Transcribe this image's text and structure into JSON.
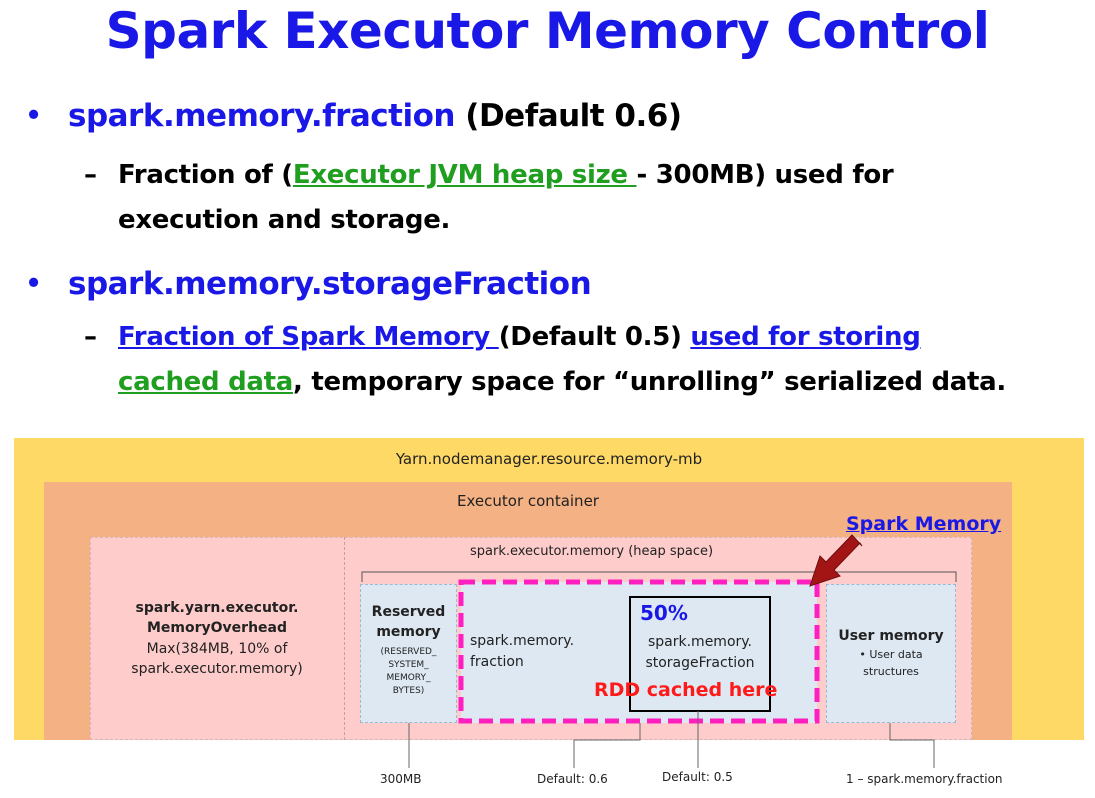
{
  "title": "Spark Executor Memory Control",
  "bullet1": {
    "key": "spark.memory.fraction",
    "rest": " (Default 0.6)"
  },
  "sub1": {
    "dash": "–",
    "pre": "Fraction of (",
    "link": "Executor JVM heap size ",
    "post": "- 300MB) used for",
    "line2": "execution and storage."
  },
  "bullet2": {
    "key": "spark.memory.storageFraction"
  },
  "sub2": {
    "dash": "–",
    "link1": "Fraction of Spark Memory ",
    "mid": "(Default 0.5) ",
    "link2": "used for storing",
    "link3": "cached data",
    "rest": ", temporary space for “unrolling” serialized data."
  },
  "diagram": {
    "yarn": "Yarn.nodemanager.resource.memory-mb",
    "container": "Executor container",
    "spark_memory_link": "Spark Memory",
    "heap": "spark.executor.memory (heap space)",
    "overhead": {
      "line1": "spark.yarn.executor.",
      "line2": "MemoryOverhead",
      "line3": "Max(384MB, 10% of",
      "line4": "spark.executor.memory)"
    },
    "reserved": {
      "line1": "Reserved",
      "line2": "memory",
      "sub1": "(RESERVED_",
      "sub2": "SYSTEM_",
      "sub3": "MEMORY_",
      "sub4": "BYTES)"
    },
    "fraction": {
      "line1": "spark.memory.",
      "line2": "fraction"
    },
    "storage": {
      "pct": "50%",
      "line1": "spark.memory.",
      "line2": "storageFraction",
      "rdd": "RDD cached here"
    },
    "user": {
      "title": "User memory",
      "bullet": "•",
      "sub1": "User data",
      "sub2": "structures"
    },
    "bottom": {
      "a": "300MB",
      "b": "Default: 0.6",
      "c": "Default: 0.5",
      "d": "1 – spark.memory.fraction"
    },
    "colors": {
      "yarn_bg": "#ffd966",
      "container_bg": "#f4b183",
      "heap_bg": "#ffcccc",
      "inner_bg": "#dde8f3",
      "dash_magenta": "#ff1fbf",
      "arrow": "#a31515",
      "rdd_red": "#ff1a1a"
    }
  }
}
